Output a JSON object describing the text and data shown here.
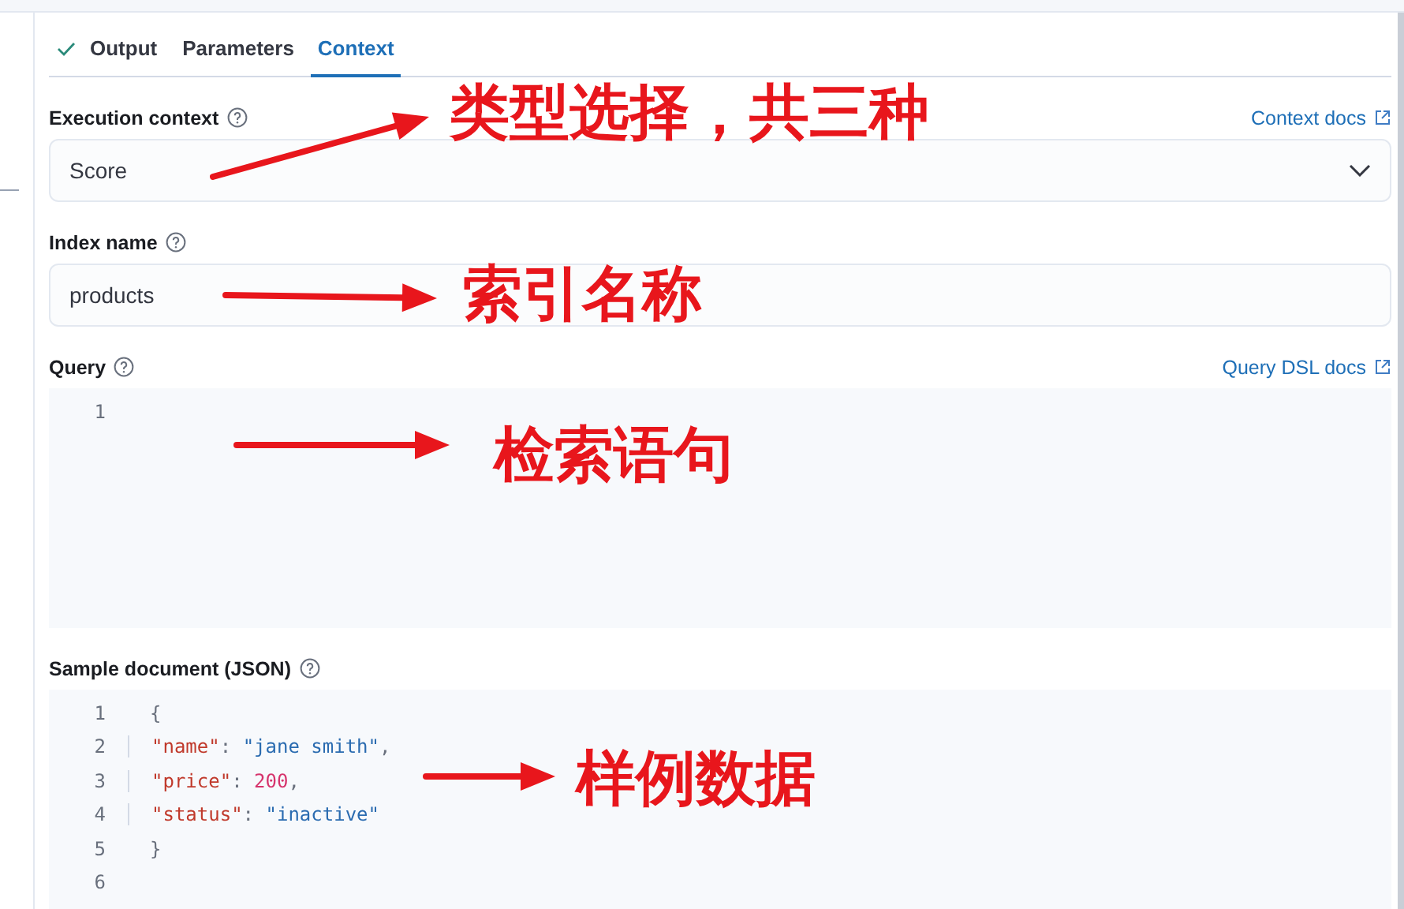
{
  "tabs": [
    {
      "label": "Output",
      "selected": false,
      "done": true
    },
    {
      "label": "Parameters",
      "selected": false,
      "done": false
    },
    {
      "label": "Context",
      "selected": true,
      "done": false
    }
  ],
  "execution_context": {
    "label": "Execution context",
    "link": "Context docs",
    "value": "Score"
  },
  "index_name": {
    "label": "Index name",
    "value": "products"
  },
  "query": {
    "label": "Query",
    "link": "Query DSL docs",
    "lines": [
      {
        "number": "1"
      }
    ]
  },
  "sample_document": {
    "label": "Sample document (JSON)",
    "lines": [
      {
        "number": "1",
        "tokens": [
          {
            "kind": "punct",
            "text": "{"
          }
        ]
      },
      {
        "number": "2",
        "tokens": [
          {
            "kind": "key",
            "text": "\"name\""
          },
          {
            "kind": "punct",
            "text": ": "
          },
          {
            "kind": "string",
            "text": "\"jane smith\""
          },
          {
            "kind": "punct",
            "text": ","
          }
        ]
      },
      {
        "number": "3",
        "tokens": [
          {
            "kind": "key",
            "text": "\"price\""
          },
          {
            "kind": "punct",
            "text": ": "
          },
          {
            "kind": "number",
            "text": "200"
          },
          {
            "kind": "punct",
            "text": ","
          }
        ]
      },
      {
        "number": "4",
        "tokens": [
          {
            "kind": "key",
            "text": "\"status\""
          },
          {
            "kind": "punct",
            "text": ": "
          },
          {
            "kind": "string",
            "text": "\"inactive\""
          }
        ]
      },
      {
        "number": "5",
        "tokens": [
          {
            "kind": "punct",
            "text": "}"
          }
        ]
      },
      {
        "number": "6"
      }
    ]
  },
  "annotations": [
    {
      "text": "类型选择，共三种"
    },
    {
      "text": "索引名称"
    },
    {
      "text": "检索语句"
    },
    {
      "text": "样例数据"
    }
  ]
}
